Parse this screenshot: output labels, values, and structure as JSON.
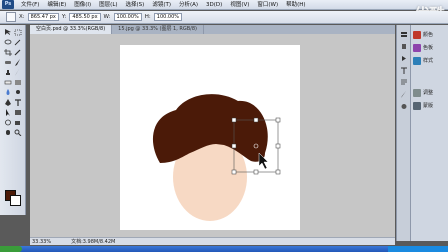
{
  "app": {
    "logo": "Ps"
  },
  "watermark": "优酷",
  "menu": [
    "文件(F)",
    "编辑(E)",
    "图像(I)",
    "图层(L)",
    "选择(S)",
    "滤镜(T)",
    "分析(A)",
    "3D(D)",
    "视图(V)",
    "窗口(W)",
    "帮助(H)"
  ],
  "options": {
    "x_label": "X:",
    "x_value": "865.47 px",
    "y_label": "Y:",
    "y_value": "485.50 px",
    "w_label": "W:",
    "w_value": "100.00%",
    "h_label": "H:",
    "h_value": "100.00%"
  },
  "tabs": [
    "空白页.psd @ 33.3%(RGB/8)",
    "15.jpg @ 33.3% (图层 1, RGB/8)"
  ],
  "status": {
    "zoom": "33.33%",
    "doc_size": "文档:3.98M/8.42M"
  },
  "panels": [
    {
      "icon": "color-icon",
      "label": "颜色",
      "color": "#c0392b"
    },
    {
      "icon": "swatches-icon",
      "label": "色板",
      "color": "#8e44ad"
    },
    {
      "icon": "styles-icon",
      "label": "样式",
      "color": "#2c7fb8"
    },
    {
      "icon": "adjustments-icon",
      "label": "调整",
      "color": "#7f8c8d"
    },
    {
      "icon": "masks-icon",
      "label": "蒙版",
      "color": "#566573"
    }
  ],
  "colors": {
    "hair": "#4b1a08",
    "skin": "#f7d9c4",
    "foreground": "#4b1a08",
    "background": "#ffffff"
  }
}
